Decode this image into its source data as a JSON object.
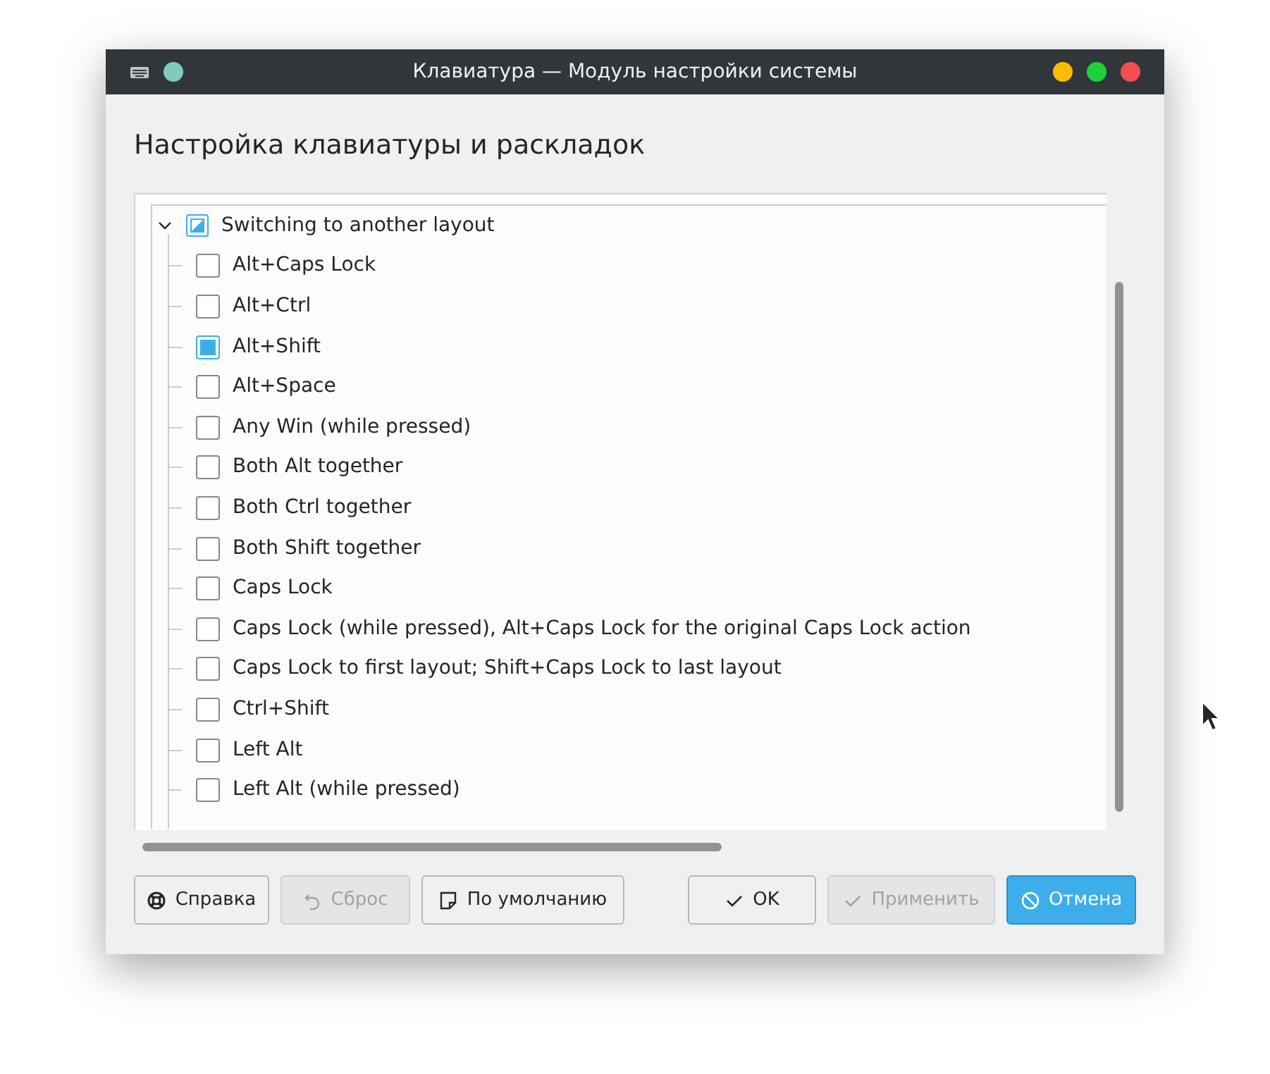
{
  "window": {
    "title": "Клавиатура — Модуль настройки системы"
  },
  "heading": "Настройка клавиатуры и раскладок",
  "tree": {
    "label": "Switching to another layout",
    "expanded": true,
    "partial": true,
    "children": [
      {
        "label": "Alt+Caps Lock",
        "checked": false
      },
      {
        "label": "Alt+Ctrl",
        "checked": false
      },
      {
        "label": "Alt+Shift",
        "checked": true
      },
      {
        "label": "Alt+Space",
        "checked": false
      },
      {
        "label": "Any Win (while pressed)",
        "checked": false
      },
      {
        "label": "Both Alt together",
        "checked": false
      },
      {
        "label": "Both Ctrl together",
        "checked": false
      },
      {
        "label": "Both Shift together",
        "checked": false
      },
      {
        "label": "Caps Lock",
        "checked": false
      },
      {
        "label": "Caps Lock (while pressed), Alt+Caps Lock for the original Caps Lock action",
        "checked": false
      },
      {
        "label": "Caps Lock to first layout; Shift+Caps Lock to last layout",
        "checked": false
      },
      {
        "label": "Ctrl+Shift",
        "checked": false
      },
      {
        "label": "Left Alt",
        "checked": false
      },
      {
        "label": "Left Alt (while pressed)",
        "checked": false
      }
    ]
  },
  "buttons_left": [
    {
      "label": "Справка",
      "disabled": false
    },
    {
      "label": "Сброс",
      "disabled": true
    },
    {
      "label": "По умолчанию",
      "disabled": false
    }
  ],
  "buttons_right": [
    {
      "label": "OK",
      "disabled": false,
      "focused": false
    },
    {
      "label": "Применить",
      "disabled": true,
      "focused": false
    },
    {
      "label": "Отмена",
      "disabled": false,
      "focused": true
    }
  ]
}
